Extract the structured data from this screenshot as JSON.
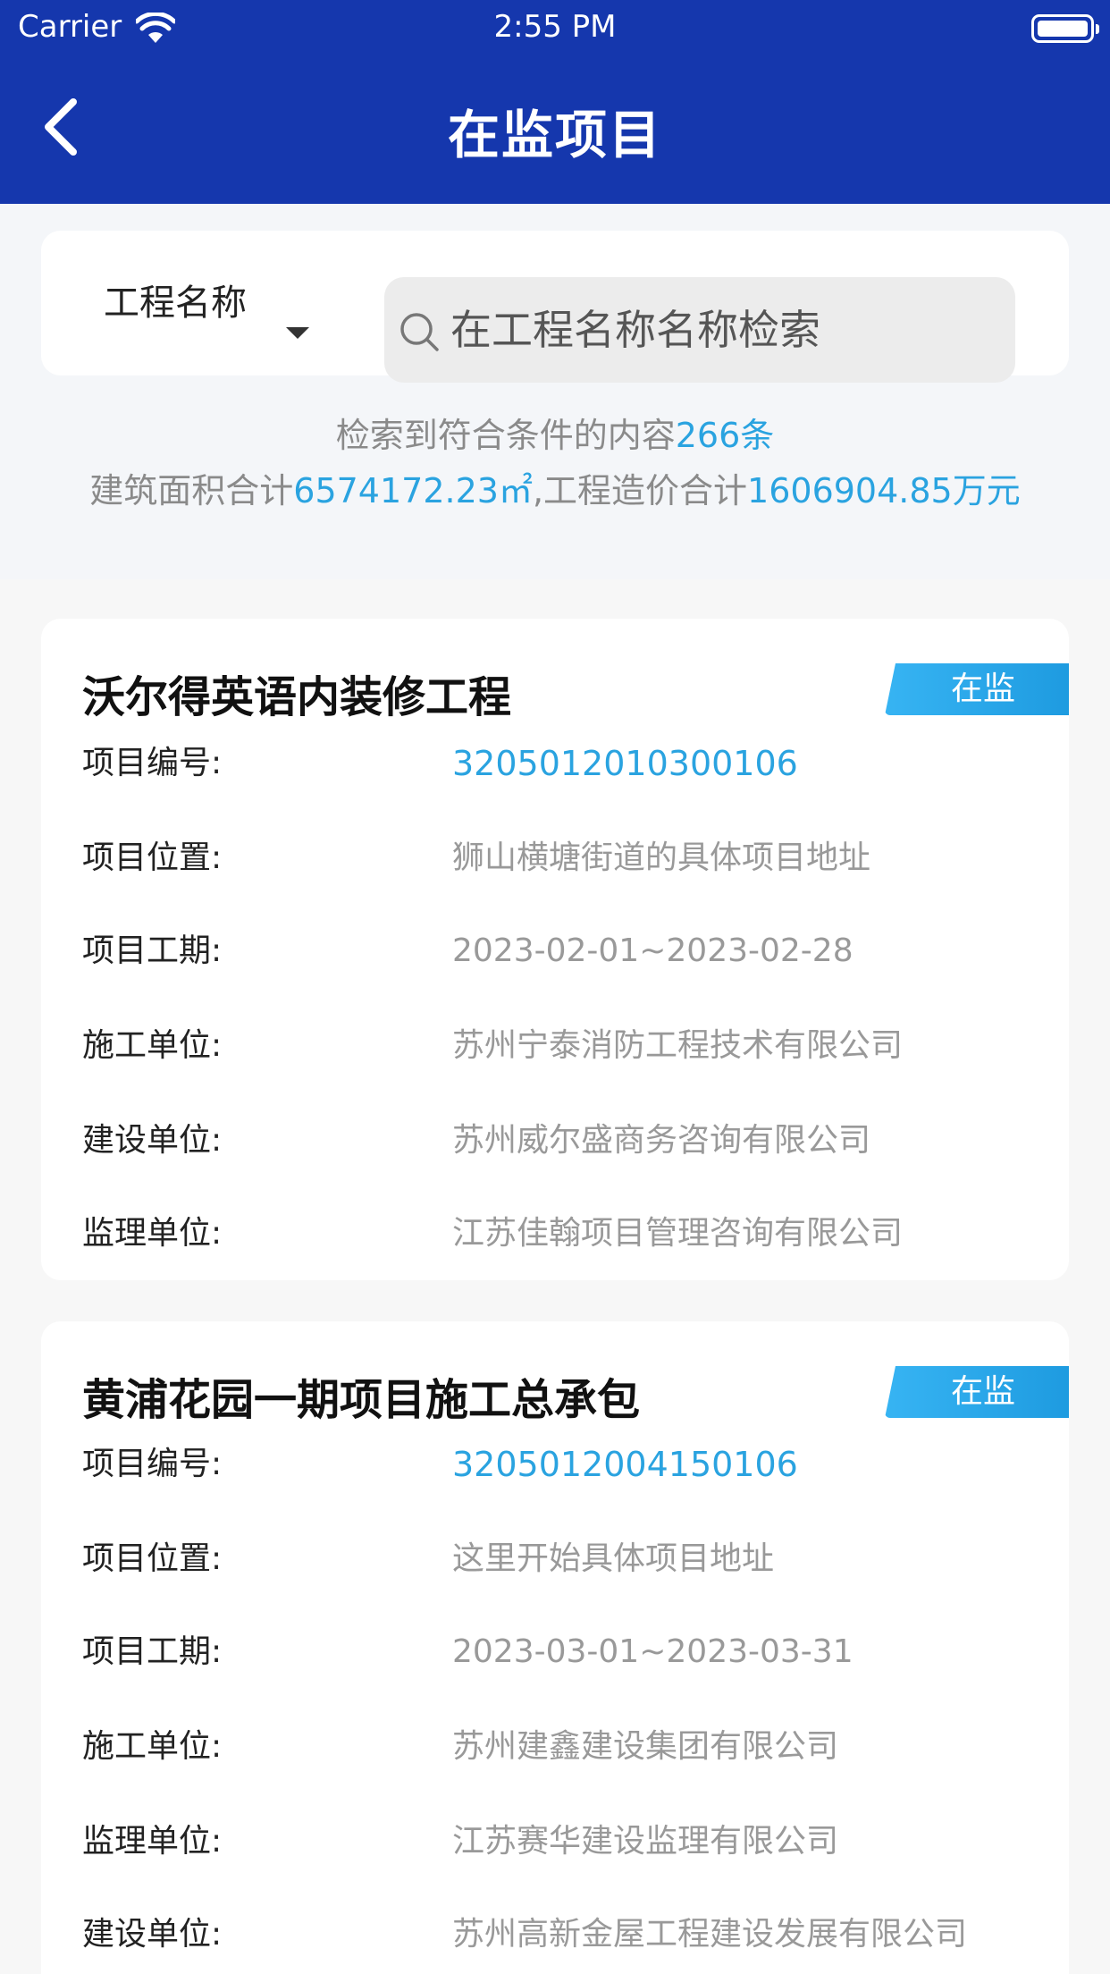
{
  "status_bar": {
    "carrier": "Carrier",
    "time": "2:55 PM"
  },
  "nav": {
    "title": "在监项目",
    "back_icon": "chevron-left-icon"
  },
  "search": {
    "field_label": "工程名称",
    "placeholder": "在工程名称名称检索"
  },
  "summary": {
    "line1_prefix": "检索到符合条件的内容",
    "count": "266条",
    "line2_prefix": "建筑面积合计",
    "area": "6574172.23㎡",
    "line2_mid": ",工程造价合计",
    "cost": "1606904.85万元"
  },
  "colors": {
    "header_bg": "#1537ad",
    "accent": "#2aa3e0",
    "badge": "#2ba8ec"
  },
  "projects": [
    {
      "title": "沃尔得英语内装修工程",
      "status": "在监",
      "fields": [
        {
          "label": "项目编号:",
          "value": "3205012010300106"
        },
        {
          "label": "项目位置:",
          "value": "狮山横塘街道的具体项目地址"
        },
        {
          "label": "项目工期:",
          "value": "2023-02-01~2023-02-28"
        },
        {
          "label": "施工单位:",
          "value": "苏州宁泰消防工程技术有限公司"
        },
        {
          "label": "建设单位:",
          "value": "苏州威尔盛商务咨询有限公司"
        },
        {
          "label": "监理单位:",
          "value": "江苏佳翰项目管理咨询有限公司"
        }
      ]
    },
    {
      "title": "黄浦花园一期项目施工总承包",
      "status": "在监",
      "fields": [
        {
          "label": "项目编号:",
          "value": "3205012004150106"
        },
        {
          "label": "项目位置:",
          "value": "这里开始具体项目地址"
        },
        {
          "label": "项目工期:",
          "value": "2023-03-01~2023-03-31"
        },
        {
          "label": "施工单位:",
          "value": "苏州建鑫建设集团有限公司"
        },
        {
          "label": "监理单位:",
          "value": "江苏赛华建设监理有限公司"
        },
        {
          "label": "建设单位:",
          "value": "苏州高新金屋工程建设发展有限公司"
        }
      ]
    }
  ]
}
